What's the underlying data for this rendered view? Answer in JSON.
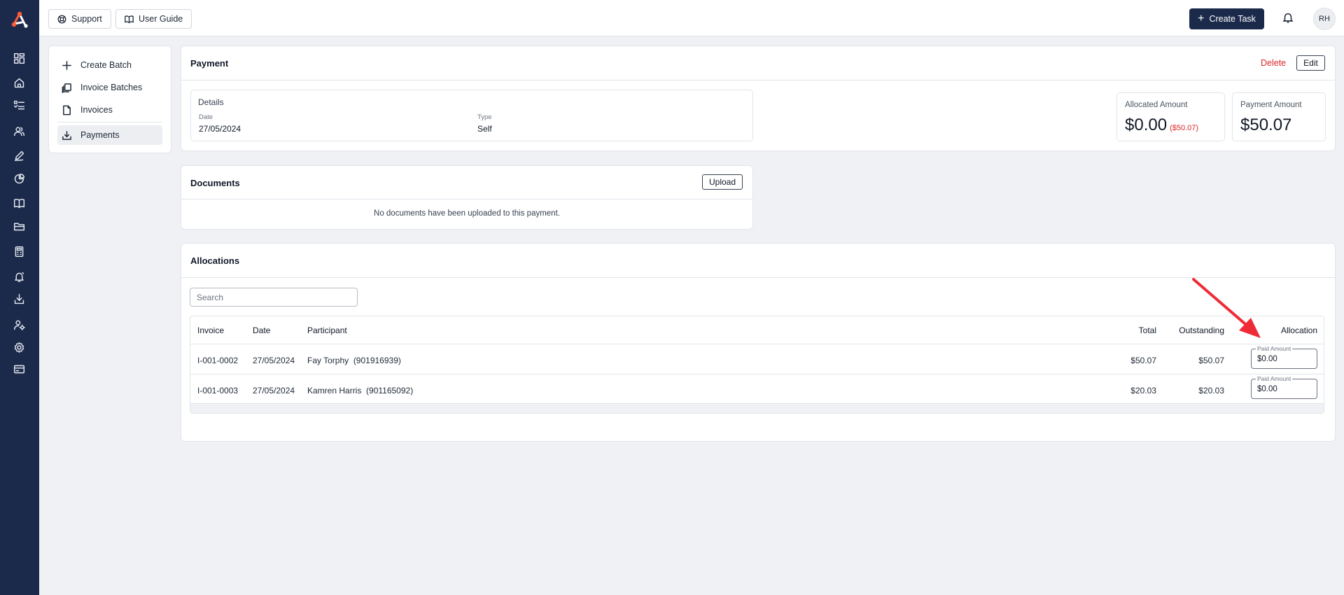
{
  "colors": {
    "rail": "#1b2a4b",
    "accent": "#1b2a4b",
    "danger": "#dc2626",
    "arrow": "#ef2b36"
  },
  "rail": {
    "icons": [
      "dashboard-icon",
      "home-icon",
      "list-icon",
      "users-icon",
      "pen-icon",
      "pie-chart-icon",
      "book-icon",
      "folder-icon",
      "calculator-icon",
      "bell-alert-icon",
      "download-icon",
      "user-settings-icon",
      "gear-icon",
      "credit-card-icon"
    ]
  },
  "topbar": {
    "support_label": "Support",
    "guide_label": "User Guide",
    "create_task_label": "Create Task",
    "avatar_initials": "RH"
  },
  "subnav": {
    "items": [
      {
        "label": "Create Batch",
        "icon": "plus-icon"
      },
      {
        "label": "Invoice Batches",
        "icon": "copy-icon"
      },
      {
        "label": "Invoices",
        "icon": "file-icon"
      },
      {
        "label": "Payments",
        "icon": "download-icon"
      }
    ]
  },
  "payment": {
    "title": "Payment",
    "delete_label": "Delete",
    "edit_label": "Edit",
    "details_title": "Details",
    "date_label": "Date",
    "date_value": "27/05/2024",
    "type_label": "Type",
    "type_value": "Self",
    "allocated_label": "Allocated Amount",
    "allocated_value": "$0.00",
    "allocated_outstanding": "($50.07)",
    "payment_amount_label": "Payment Amount",
    "payment_amount_value": "$50.07"
  },
  "documents": {
    "title": "Documents",
    "upload_label": "Upload",
    "empty_text": "No documents have been uploaded to this payment."
  },
  "allocations": {
    "title": "Allocations",
    "search_placeholder": "Search",
    "columns": {
      "invoice": "Invoice",
      "date": "Date",
      "participant": "Participant",
      "total": "Total",
      "outstanding": "Outstanding",
      "allocation": "Allocation"
    },
    "paid_amount_label": "Paid Amount",
    "rows": [
      {
        "invoice": "I-001-0002",
        "date": "27/05/2024",
        "participant": "Fay Torphy",
        "participant_id": "(901916939)",
        "total": "$50.07",
        "outstanding": "$50.07",
        "paid": "$0.00"
      },
      {
        "invoice": "I-001-0003",
        "date": "27/05/2024",
        "participant": "Kamren Harris",
        "participant_id": "(901165092)",
        "total": "$20.03",
        "outstanding": "$20.03",
        "paid": "$0.00"
      }
    ]
  }
}
